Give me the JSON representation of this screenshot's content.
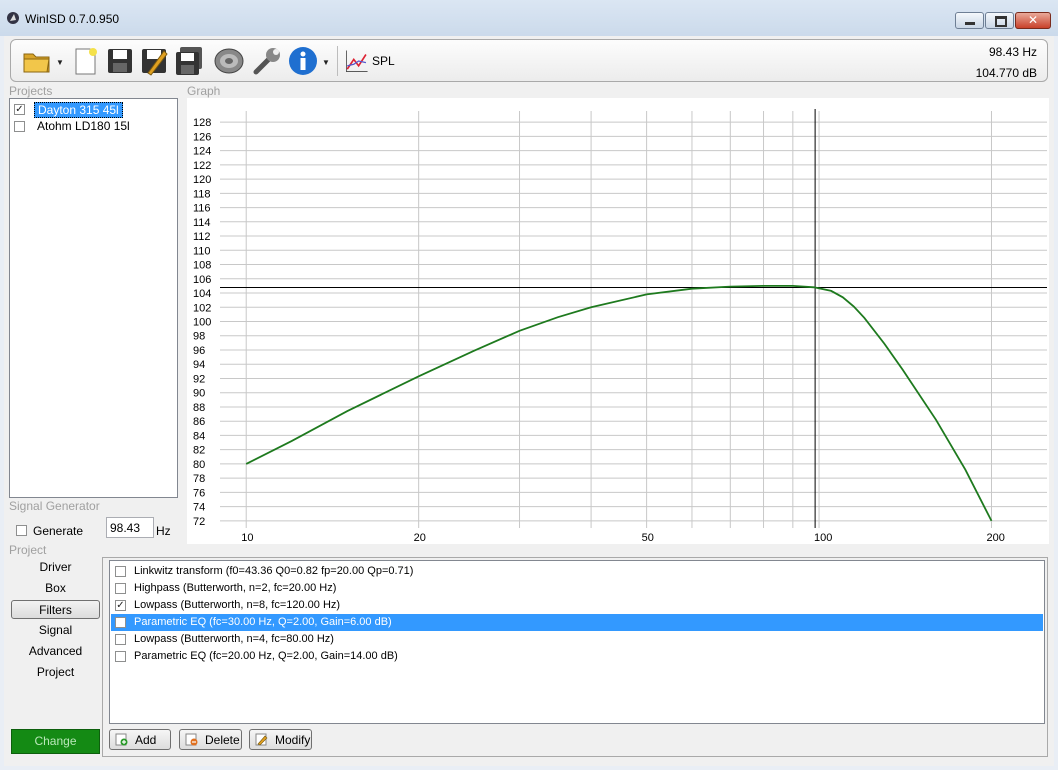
{
  "window": {
    "title": "WinISD 0.7.0.950"
  },
  "toolbar": {
    "icons": [
      "open-folder-icon",
      "new-document-icon",
      "save-icon",
      "save-as-icon",
      "save-all-icon",
      "speaker-driver-icon",
      "wrench-icon",
      "info-icon",
      "spl-graph-icon"
    ],
    "graph_label": "SPL",
    "cursor_frequency": "98.43 Hz",
    "cursor_level": "104.770 dB"
  },
  "projects": {
    "label": "Projects",
    "items": [
      {
        "name": "Dayton 315 45l",
        "checked": true,
        "selected": true
      },
      {
        "name": "Atohm LD180 15l",
        "checked": false,
        "selected": false
      }
    ]
  },
  "graph": {
    "label": "Graph"
  },
  "signal_generator": {
    "label": "Signal Generator",
    "generate_label": "Generate",
    "frequency": "98.43",
    "unit": "Hz"
  },
  "project_nav": {
    "label": "Project",
    "items": [
      "Driver",
      "Box",
      "Filters",
      "Signal",
      "Advanced",
      "Project"
    ],
    "active": "Filters",
    "change_label": "Change"
  },
  "filters": {
    "items": [
      {
        "text": "Linkwitz transform (f0=43.36 Q0=0.82 fp=20.00 Qp=0.71)",
        "checked": false,
        "selected": false
      },
      {
        "text": "Highpass (Butterworth, n=2, fc=20.00 Hz)",
        "checked": false,
        "selected": false
      },
      {
        "text": "Lowpass (Butterworth, n=8, fc=120.00 Hz)",
        "checked": true,
        "selected": false
      },
      {
        "text": "Parametric EQ (fc=30.00 Hz, Q=2.00, Gain=6.00 dB)",
        "checked": false,
        "selected": true
      },
      {
        "text": "Lowpass (Butterworth, n=4, fc=80.00 Hz)",
        "checked": false,
        "selected": false
      },
      {
        "text": "Parametric EQ (fc=20.00 Hz, Q=2.00, Gain=14.00 dB)",
        "checked": false,
        "selected": false
      }
    ],
    "add_label": "Add",
    "delete_label": "Delete",
    "modify_label": "Modify"
  },
  "colors": {
    "selection": "#3399ff",
    "curve": "#1e7a1e",
    "change_button": "#148a14"
  },
  "chart_data": {
    "type": "line",
    "x_scale": "log",
    "xlim": [
      9,
      250
    ],
    "ylim": [
      71,
      129
    ],
    "x_ticks": [
      10,
      20,
      50,
      100,
      200
    ],
    "y_ticks": [
      72,
      74,
      76,
      78,
      80,
      82,
      84,
      86,
      88,
      90,
      92,
      94,
      96,
      98,
      100,
      102,
      104,
      106,
      108,
      110,
      112,
      114,
      116,
      118,
      120,
      122,
      124,
      126,
      128
    ],
    "cursor": {
      "x": 98.43,
      "y": 104.77
    },
    "grid": true,
    "series": [
      {
        "x": [
          10,
          12,
          15,
          20,
          25,
          30,
          35,
          40,
          50,
          60,
          70,
          80,
          90,
          98,
          105,
          110,
          115,
          120,
          130,
          140,
          160,
          180,
          200
        ],
        "y": [
          80,
          83.2,
          87.4,
          92.3,
          95.9,
          98.7,
          100.6,
          102.0,
          103.8,
          104.6,
          104.9,
          105.0,
          105.0,
          104.8,
          104.3,
          103.4,
          102.1,
          100.5,
          96.9,
          93.2,
          86.2,
          79.2,
          72
        ]
      }
    ]
  }
}
